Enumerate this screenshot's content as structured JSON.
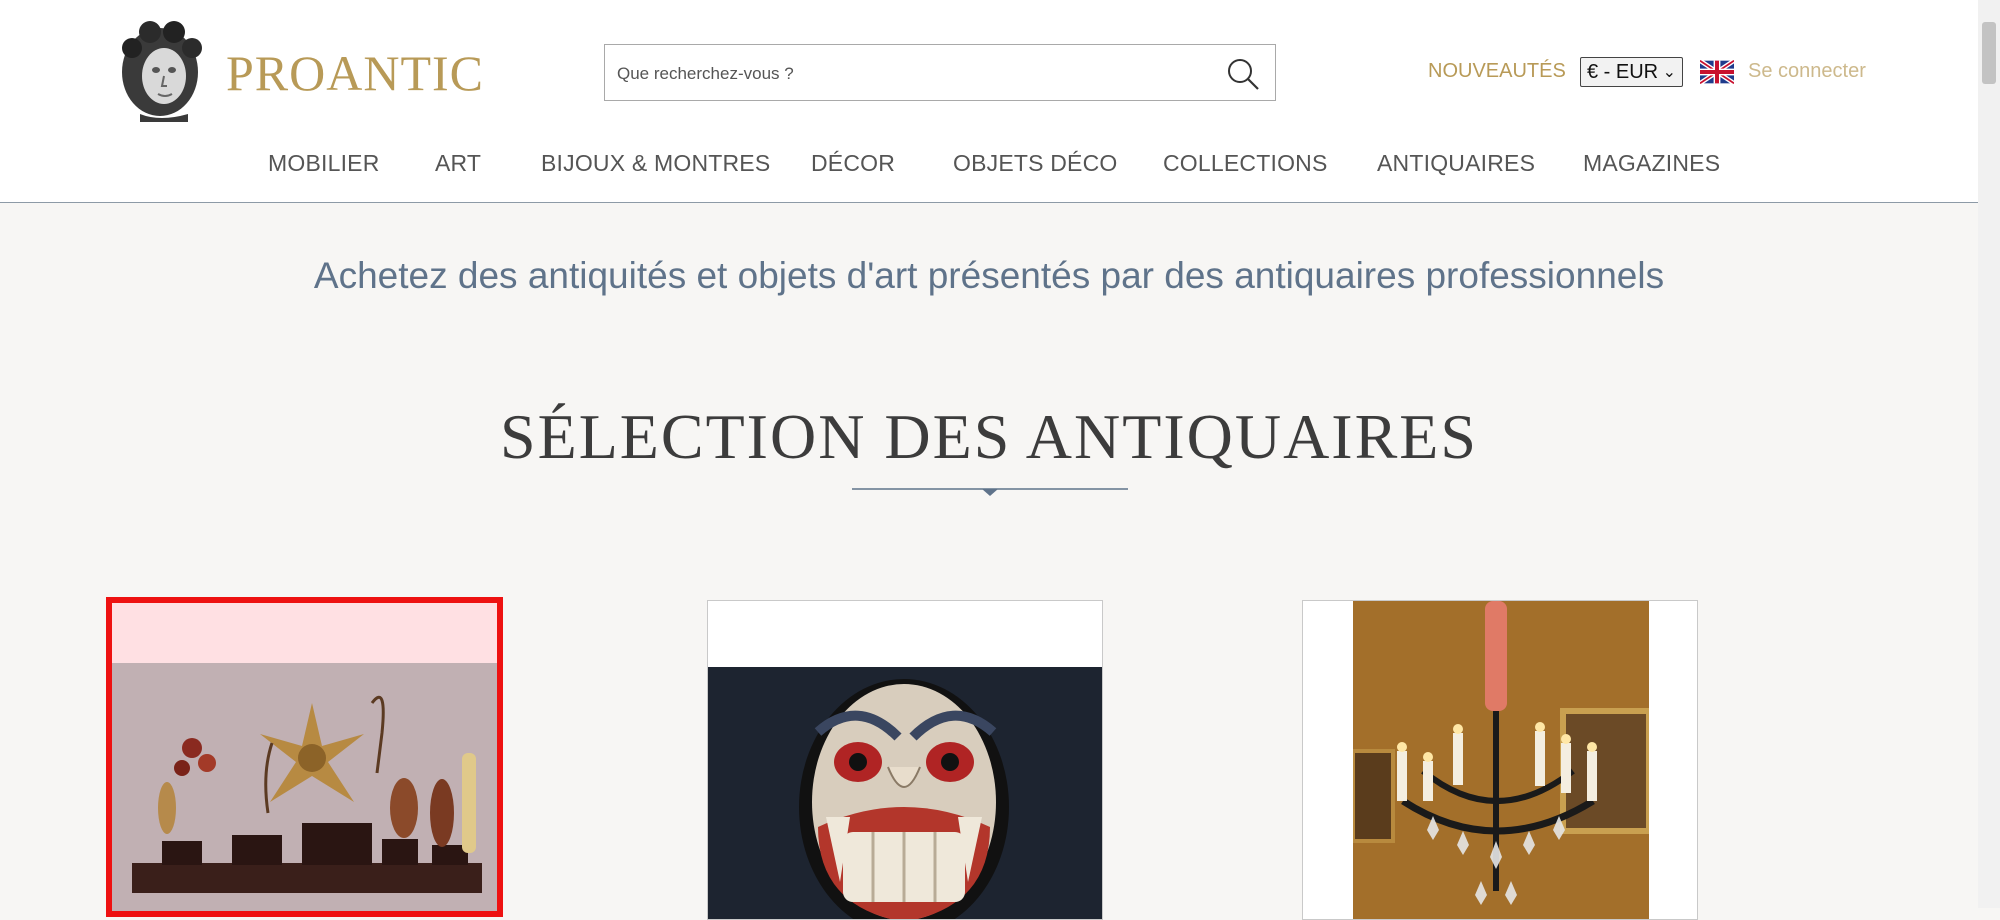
{
  "header": {
    "logo_text": "PROANTIC",
    "search": {
      "placeholder": "Que recherchez-vous ?"
    },
    "new_link": "NOUVEAUTÉS",
    "currency": "€ - EUR",
    "login": "Se connecter"
  },
  "nav": {
    "items": [
      {
        "label": "MOBILIER"
      },
      {
        "label": "ART"
      },
      {
        "label": "BIJOUX & MONTRES"
      },
      {
        "label": "DÉCOR"
      },
      {
        "label": "OBJETS DÉCO"
      },
      {
        "label": "COLLECTIONS"
      },
      {
        "label": "ANTIQUAIRES"
      },
      {
        "label": "MAGAZINES"
      }
    ]
  },
  "main": {
    "tagline": "Achetez des antiquités et objets d'art présentés par des antiquaires professionnels",
    "section_title": "SÉLECTION DES ANTIQUAIRES"
  },
  "colors": {
    "brand_gold": "#b89a57",
    "tagline_blue": "#5f738a",
    "highlight_red": "#ee1111"
  }
}
